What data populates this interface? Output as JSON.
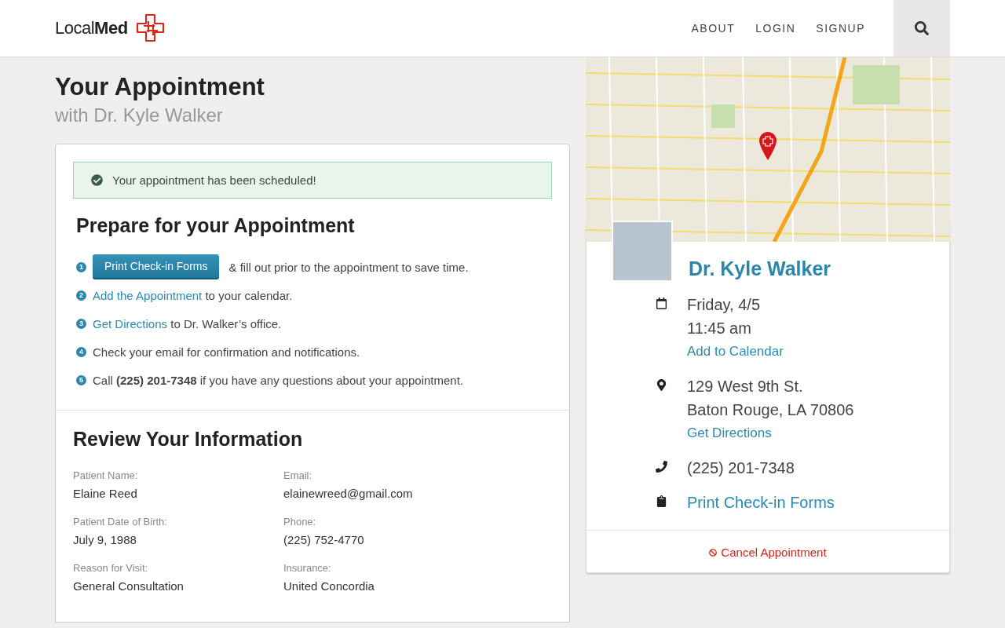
{
  "header": {
    "logo": "Local**Med**",
    "nav": [
      "ABOUT",
      "LOGIN",
      "SIGNUP"
    ]
  },
  "page": {
    "title": "Your Appointment",
    "subtitle": "with Dr. Kyle Walker"
  },
  "alert": {
    "kind": "success",
    "text": "Your appointment has been scheduled!"
  },
  "prepare": {
    "title": "Prepare for your Appointment",
    "steps": [
      {
        "number": "1",
        "kind": "button",
        "action": "Print Check-in Forms",
        "rest": "& fill out prior to the appointment to save time."
      },
      {
        "number": "2",
        "kind": "link",
        "action": "Add the Appointment",
        "rest": "to your calendar."
      },
      {
        "number": "3",
        "kind": "link",
        "action": "Get Directions",
        "rest": "to Dr. Walker’s office."
      },
      {
        "number": "4",
        "kind": "text",
        "rest": "Check your email for confirmation and notifications."
      },
      {
        "number": "5",
        "kind": "text",
        "rest": "Call **(225) 201-7348** if you have any questions about your appointment."
      }
    ]
  },
  "review": {
    "title": "Review Your Information",
    "fields": [
      {
        "label": "Patient Name:",
        "value": "Elaine Reed"
      },
      {
        "label": "Email:",
        "value": "elainewreed@gmail.com"
      },
      {
        "label": "Patient Date of Birth:",
        "value": "July 9, 1988"
      },
      {
        "label": "Phone:",
        "value": "(225) 752-4770"
      },
      {
        "label": "Reason for Visit:",
        "value": "General Consultation"
      },
      {
        "label": "Insurance:",
        "value": "United Concordia"
      }
    ]
  },
  "doctor": {
    "name": "Dr. Kyle Walker",
    "details": [
      {
        "kind": "calendar",
        "lines": [
          "Friday, 4/5",
          "11:45 am"
        ],
        "link": "Add to Calendar"
      },
      {
        "kind": "location",
        "lines": [
          "129 West 9th St.",
          "Baton Rouge, LA 70806"
        ],
        "link": "Get Directions"
      },
      {
        "kind": "phone",
        "lines": [
          "(225) 201-7348"
        ]
      },
      {
        "kind": "clipboard",
        "link": "Print Check-in Forms"
      }
    ],
    "cancel": "Cancel Appointment"
  }
}
